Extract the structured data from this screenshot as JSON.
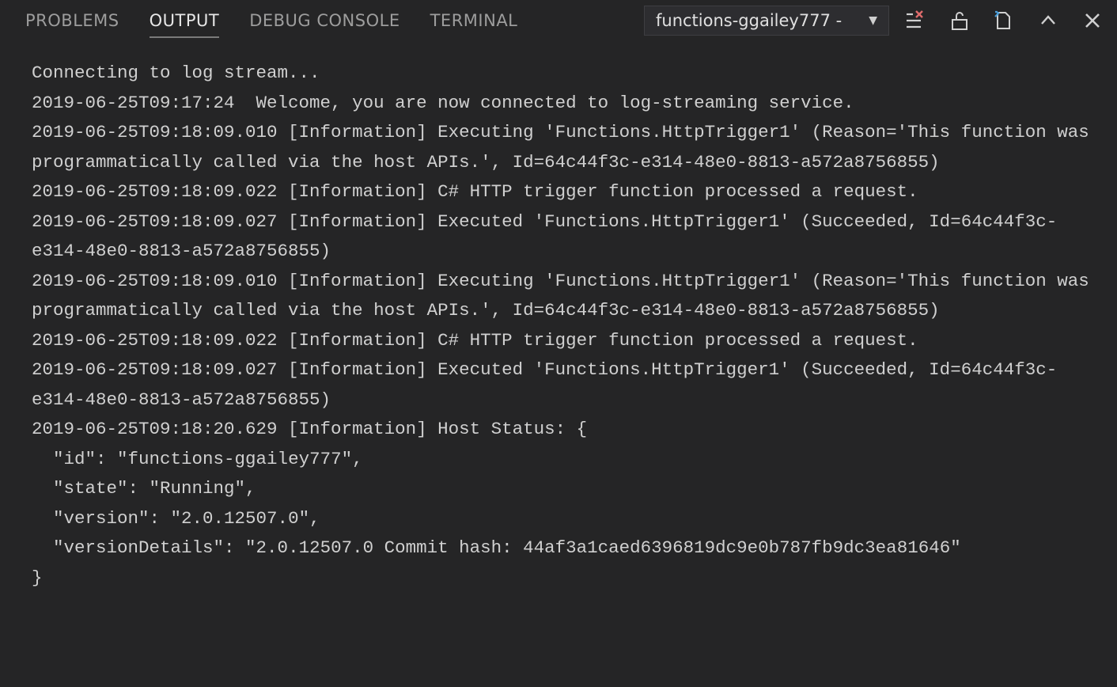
{
  "tabs": {
    "problems": "PROBLEMS",
    "output": "OUTPUT",
    "debug_console": "DEBUG CONSOLE",
    "terminal": "TERMINAL"
  },
  "dropdown": {
    "label": "functions-ggailey777 - "
  },
  "log_lines": [
    "Connecting to log stream...",
    "2019-06-25T09:17:24  Welcome, you are now connected to log-streaming service.",
    "2019-06-25T09:18:09.010 [Information] Executing 'Functions.HttpTrigger1' (Reason='This function was programmatically called via the host APIs.', Id=64c44f3c-e314-48e0-8813-a572a8756855)",
    "2019-06-25T09:18:09.022 [Information] C# HTTP trigger function processed a request.",
    "2019-06-25T09:18:09.027 [Information] Executed 'Functions.HttpTrigger1' (Succeeded, Id=64c44f3c-e314-48e0-8813-a572a8756855)",
    "2019-06-25T09:18:09.010 [Information] Executing 'Functions.HttpTrigger1' (Reason='This function was programmatically called via the host APIs.', Id=64c44f3c-e314-48e0-8813-a572a8756855)",
    "2019-06-25T09:18:09.022 [Information] C# HTTP trigger function processed a request.",
    "2019-06-25T09:18:09.027 [Information] Executed 'Functions.HttpTrigger1' (Succeeded, Id=64c44f3c-e314-48e0-8813-a572a8756855)",
    "2019-06-25T09:18:20.629 [Information] Host Status: {",
    "  \"id\": \"functions-ggailey777\",",
    "  \"state\": \"Running\",",
    "  \"version\": \"2.0.12507.0\",",
    "  \"versionDetails\": \"2.0.12507.0 Commit hash: 44af3a1caed6396819dc9e0b787fb9dc3ea81646\"",
    "}"
  ]
}
